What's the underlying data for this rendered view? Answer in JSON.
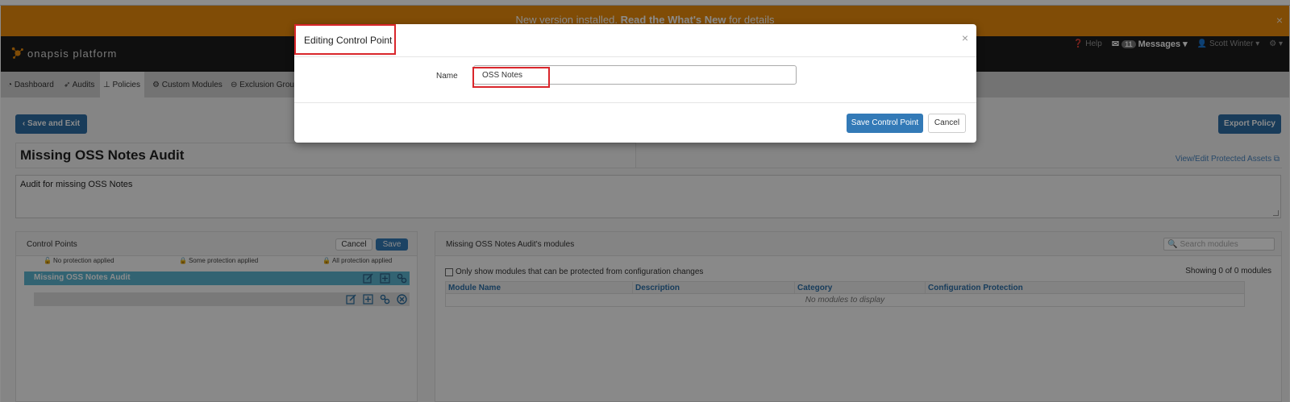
{
  "banner": {
    "prefix": "New version installed. ",
    "bold": "Read the What's New",
    "suffix": " for details",
    "close": "×"
  },
  "navbar": {
    "brand": "onapsis platform",
    "help": "Help",
    "messages_count": "11",
    "messages_label": "Messages",
    "user": "Scott Winter"
  },
  "subnav": {
    "items": [
      {
        "label": "Dashboard",
        "icon": "dashboard-icon"
      },
      {
        "label": "Audits",
        "icon": "rocket-icon"
      },
      {
        "label": "Policies",
        "icon": "sitemap-icon"
      },
      {
        "label": "Custom Modules",
        "icon": "cogs-icon"
      },
      {
        "label": "Exclusion Groups",
        "icon": "minus-circle-icon"
      }
    ]
  },
  "page": {
    "save_exit": "Save and Exit",
    "export_policy": "Export Policy",
    "title": "Missing OSS Notes Audit",
    "view_edit": "View/Edit Protected Assets",
    "description": "Audit for missing OSS Notes"
  },
  "control_points": {
    "title": "Control Points",
    "cancel": "Cancel",
    "save": "Save",
    "legend": {
      "none": "No protection applied",
      "some": "Some protection applied",
      "all": "All protection applied"
    },
    "selected_item": "Missing OSS Notes Audit"
  },
  "modules": {
    "title": "Missing OSS Notes Audit's modules",
    "search_placeholder": "Search modules",
    "only_show": "Only show modules that can be protected from configuration changes",
    "showing": "Showing 0 of 0 modules",
    "columns": [
      "Module Name",
      "Description",
      "Category",
      "Configuration Protection"
    ],
    "empty": "No modules to display"
  },
  "modal": {
    "title": "Editing Control Point",
    "close": "×",
    "name_label": "Name",
    "name_value": "OSS Notes",
    "save_button": "Save Control Point",
    "cancel_button": "Cancel"
  },
  "colors": {
    "banner": "#e98b0c",
    "navbar": "#1c1c1c",
    "primary": "#337ab7",
    "highlight": "#d9262b",
    "selected_row": "#5bb4cf"
  }
}
